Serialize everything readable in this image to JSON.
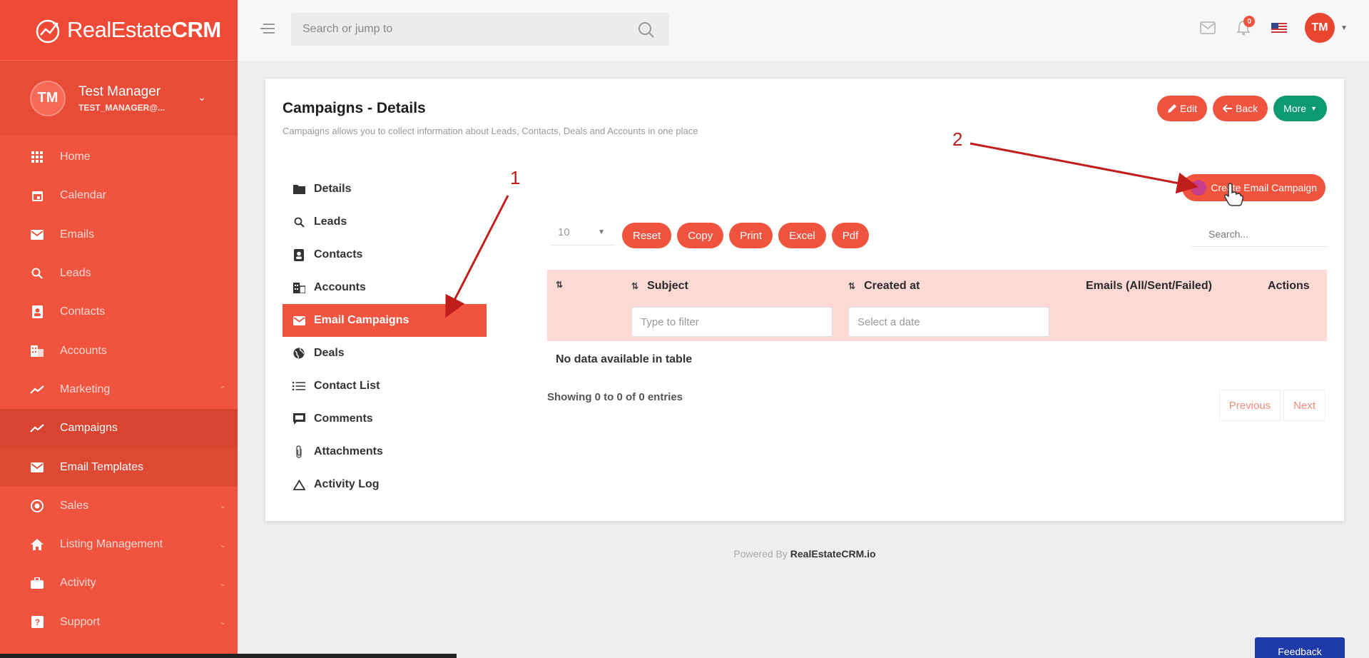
{
  "brand": {
    "name_light": "RealEstate",
    "name_bold": "CRM"
  },
  "user": {
    "initials": "TM",
    "name": "Test Manager",
    "email": "TEST_MANAGER@..."
  },
  "sidebar": {
    "items": [
      {
        "label": "Home",
        "icon": "grid-icon"
      },
      {
        "label": "Calendar",
        "icon": "calendar-icon"
      },
      {
        "label": "Emails",
        "icon": "envelope-icon"
      },
      {
        "label": "Leads",
        "icon": "search-icon"
      },
      {
        "label": "Contacts",
        "icon": "contact-card-icon"
      },
      {
        "label": "Accounts",
        "icon": "building-icon"
      },
      {
        "label": "Marketing",
        "icon": "trend-icon"
      },
      {
        "label": "Campaigns",
        "icon": "trend-icon"
      },
      {
        "label": "Email Templates",
        "icon": "envelope-icon"
      },
      {
        "label": "Sales",
        "icon": "target-icon"
      },
      {
        "label": "Listing Management",
        "icon": "home-icon"
      },
      {
        "label": "Activity",
        "icon": "briefcase-icon"
      },
      {
        "label": "Support",
        "icon": "question-icon"
      }
    ]
  },
  "topbar": {
    "search_placeholder": "Search or jump to",
    "notification_count": "0",
    "avatar_initials": "TM"
  },
  "page": {
    "title": "Campaigns - Details",
    "subtitle": "Campaigns allows you to collect information about Leads, Contacts, Deals and Accounts in one place",
    "buttons": {
      "edit": "Edit",
      "back": "Back",
      "more": "More"
    }
  },
  "tabs": [
    {
      "label": "Details",
      "icon": "folder-icon"
    },
    {
      "label": "Leads",
      "icon": "search-icon"
    },
    {
      "label": "Contacts",
      "icon": "contact-card-icon"
    },
    {
      "label": "Accounts",
      "icon": "building-icon"
    },
    {
      "label": "Email Campaigns",
      "icon": "envelope-icon"
    },
    {
      "label": "Deals",
      "icon": "globe-icon"
    },
    {
      "label": "Contact List",
      "icon": "list-icon"
    },
    {
      "label": "Comments",
      "icon": "comment-icon"
    },
    {
      "label": "Attachments",
      "icon": "paperclip-icon"
    },
    {
      "label": "Activity Log",
      "icon": "triangle-icon"
    }
  ],
  "table": {
    "create_button": "Create Email Campaign",
    "page_length": "10",
    "tools": [
      "Reset",
      "Copy",
      "Print",
      "Excel",
      "Pdf"
    ],
    "search_placeholder": "Search...",
    "columns": [
      "Subject",
      "Created at",
      "Emails (All/Sent/Failed)",
      "Actions"
    ],
    "filter_subject_placeholder": "Type to filter",
    "filter_date_placeholder": "Select a date",
    "empty": "No data available in table",
    "info": "Showing 0 to 0 of 0 entries",
    "prev": "Previous",
    "next": "Next"
  },
  "footer": {
    "prefix": "Powered By",
    "brand": "RealEstateCRM.io"
  },
  "feedback": "Feedback",
  "annotations": {
    "one": "1",
    "two": "2"
  },
  "colors": {
    "primary": "#f0533e",
    "green": "#0d9a6e",
    "table_header": "#fcd9d4",
    "feedback": "#1d3aa8",
    "annotation": "#c21d1d"
  }
}
